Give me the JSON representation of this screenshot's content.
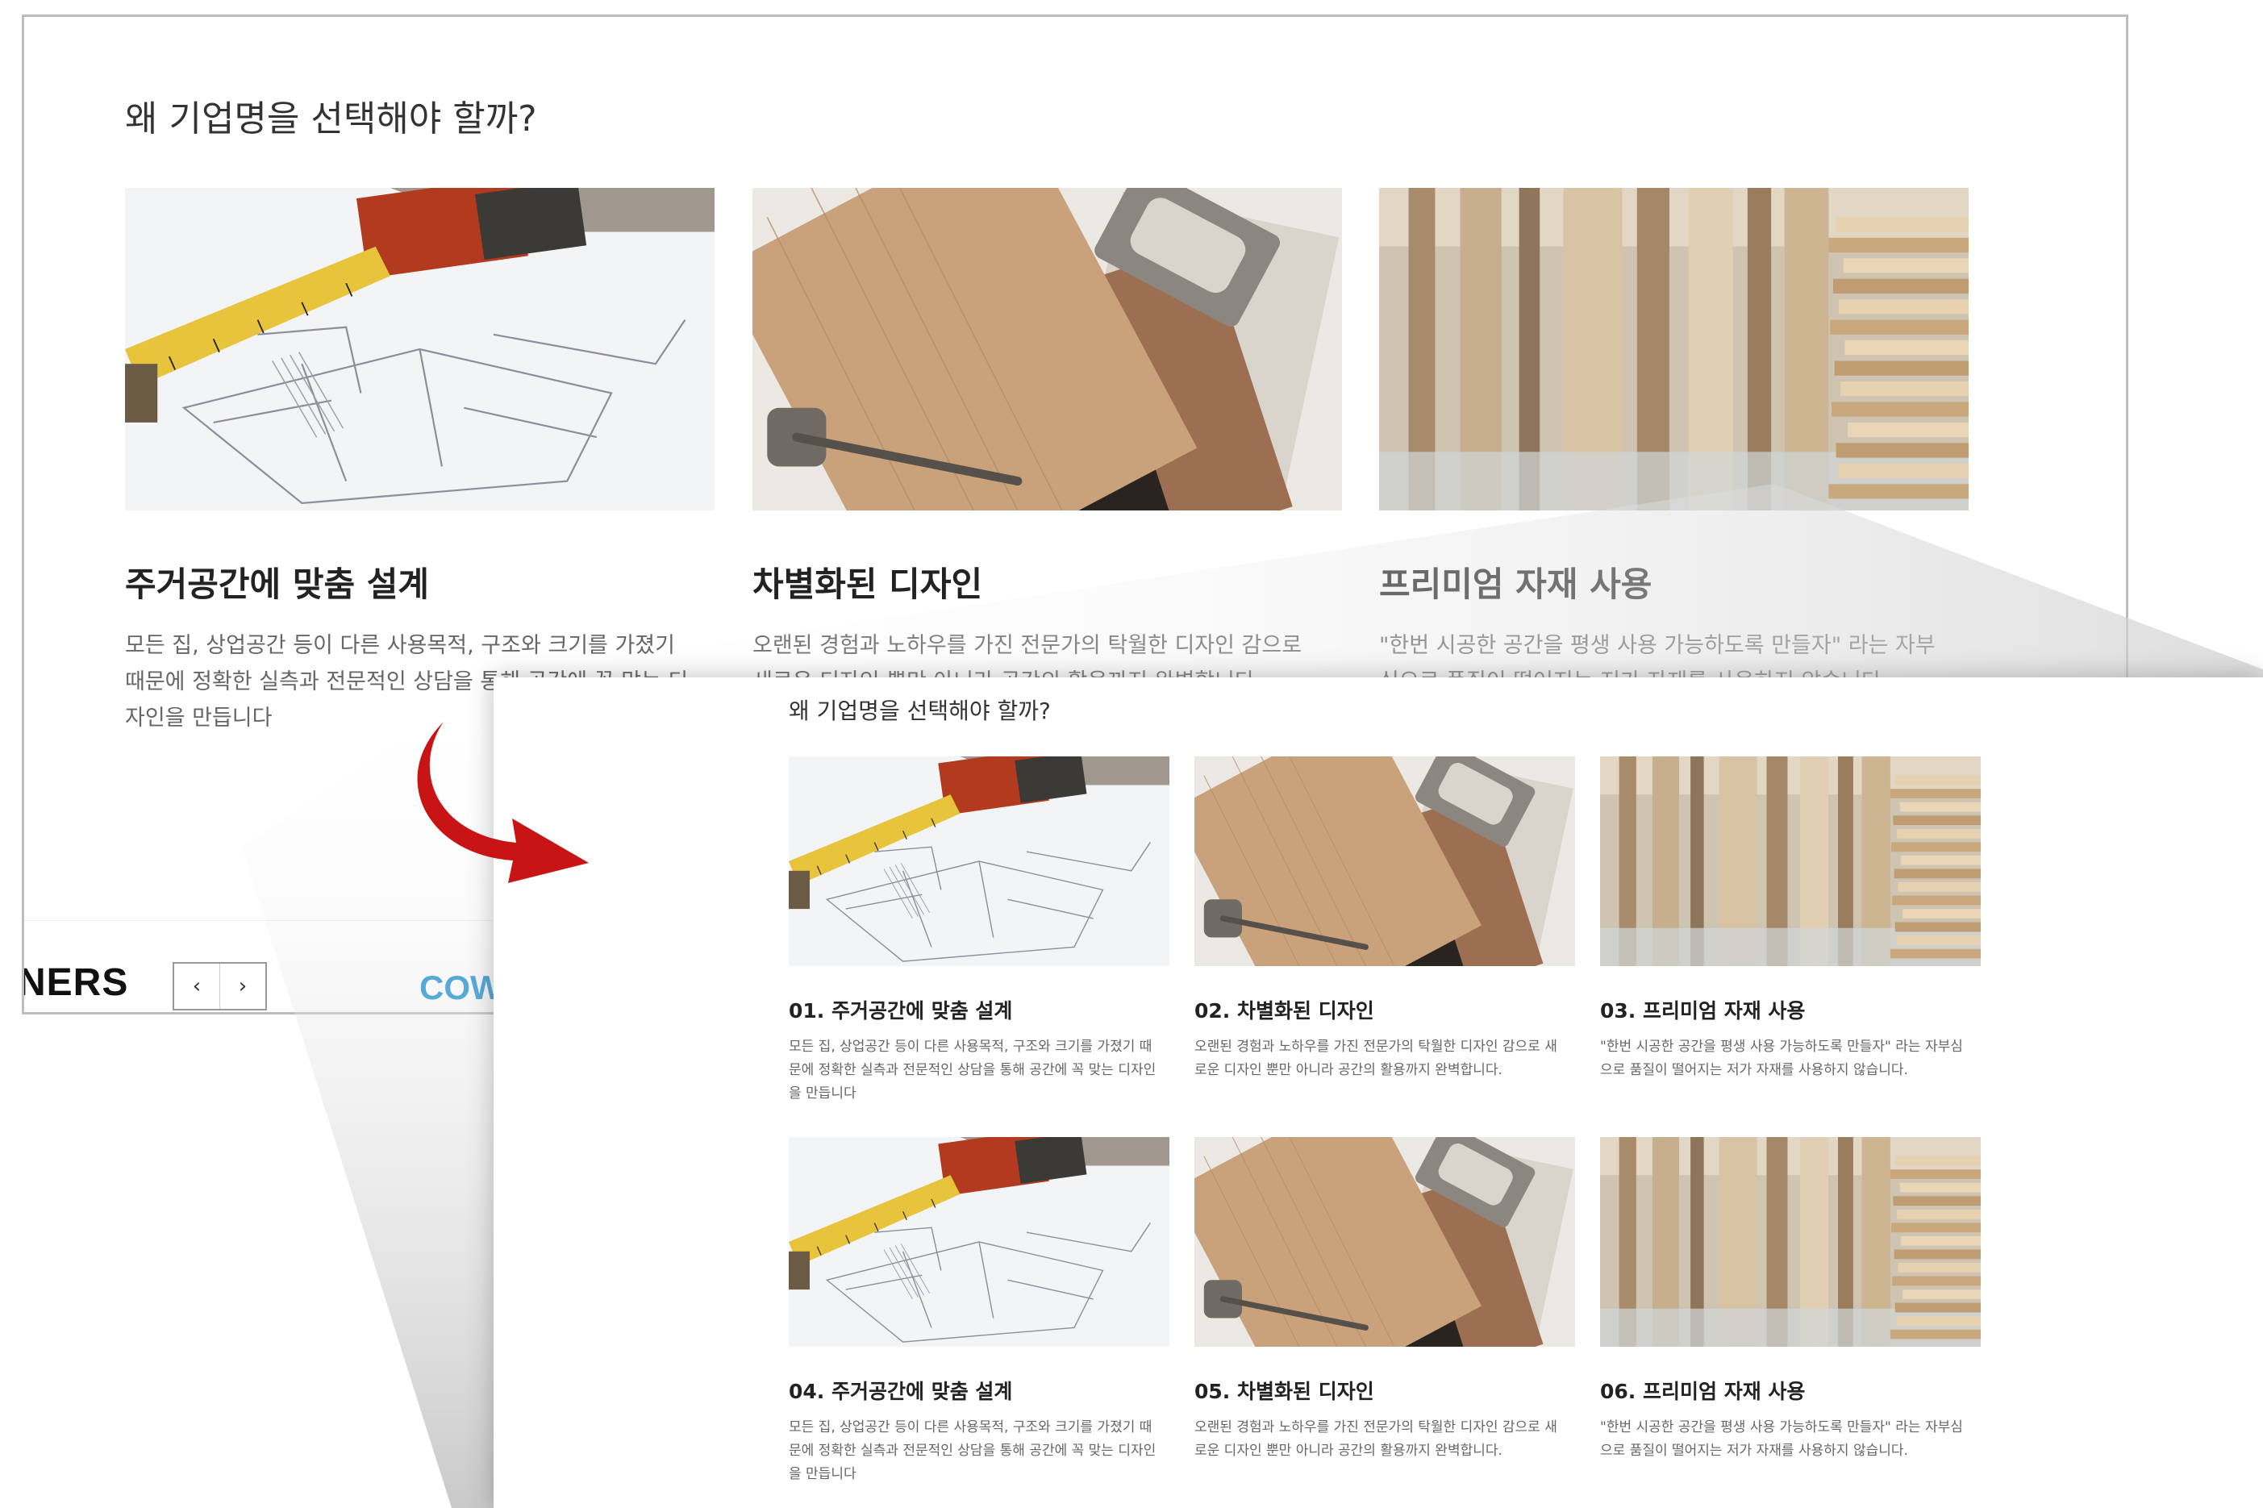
{
  "section": {
    "title": "왜 기업명을 선택해야 할까?"
  },
  "before": {
    "cards": [
      {
        "title": "주거공간에 맞춤 설계",
        "desc": "모든 집, 상업공간 등이 다른 사용목적, 구조와 크기를 가졌기 때문에 정확한 실측과 전문적인 상담을 통해 공간에 꼭 맞는 디자인을 만듭니다",
        "image": "blueprint-tape-measure"
      },
      {
        "title": "차별화된 디자인",
        "desc": "오랜된 경험과 노하우를 가진 전문가의 탁월한 디자인 감으로 새로운 디자인 뿐만 아니라 공간의 활용까지 완벽합니다.",
        "image": "wood-samples-hinge"
      },
      {
        "title": "프리미엄 자재 사용",
        "desc": "\"한번 시공한 공간을 평생 사용 가능하도록 만들자\" 라는 자부심으로 품질이 떨어지는 저가 자재를 사용하지 않습니다.",
        "image": "lumber-rack"
      }
    ],
    "partners_label": "NERS",
    "slider_prev": "‹",
    "slider_next": "›",
    "logo_fragment": "COW"
  },
  "after": {
    "cards": [
      {
        "title": "01. 주거공간에 맞춤 설계",
        "desc": "모든 집, 상업공간 등이 다른 사용목적, 구조와 크기를 가졌기 때문에 정확한 실측과 전문적인 상담을 통해 공간에 꼭 맞는 디자인을 만듭니다",
        "image": "blueprint-tape-measure"
      },
      {
        "title": "02. 차별화된 디자인",
        "desc": "오랜된 경험과 노하우를 가진 전문가의 탁월한 디자인 감으로 새로운 디자인 뿐만 아니라 공간의 활용까지 완벽합니다.",
        "image": "wood-samples-hinge"
      },
      {
        "title": "03. 프리미엄 자재 사용",
        "desc": "\"한번 시공한 공간을 평생 사용 가능하도록 만들자\" 라는 자부심으로 품질이 떨어지는 저가 자재를 사용하지 않습니다.",
        "image": "lumber-rack"
      },
      {
        "title": "04. 주거공간에 맞춤 설계",
        "desc": "모든 집, 상업공간 등이 다른 사용목적, 구조와 크기를 가졌기 때문에 정확한 실측과 전문적인 상담을 통해 공간에 꼭 맞는 디자인을 만듭니다",
        "image": "blueprint-tape-measure"
      },
      {
        "title": "05. 차별화된 디자인",
        "desc": "오랜된 경험과 노하우를 가진 전문가의 탁월한 디자인 감으로 새로운 디자인 뿐만 아니라 공간의 활용까지 완벽합니다.",
        "image": "wood-samples-hinge"
      },
      {
        "title": "06. 프리미엄 자재 사용",
        "desc": "\"한번 시공한 공간을 평생 사용 가능하도록 만들자\" 라는 자부심으로 품질이 떨어지는 저가 자재를 사용하지 않습니다.",
        "image": "lumber-rack"
      }
    ]
  },
  "colors": {
    "arrow": "#c81414",
    "accent_logo": "#1c8fd0"
  }
}
